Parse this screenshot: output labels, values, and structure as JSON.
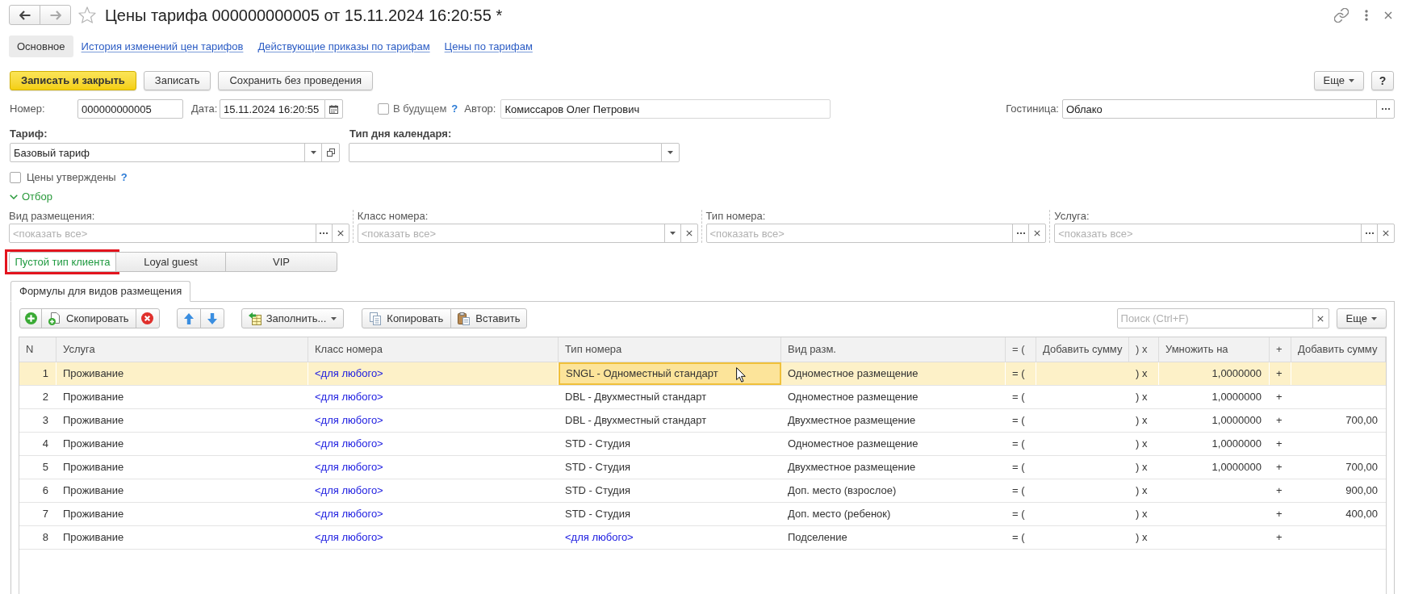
{
  "window": {
    "title": "Цены тарифа 000000000005 от 15.11.2024 16:20:55 *",
    "favorite": false
  },
  "form_tabs": [
    {
      "label": "Основное",
      "selected": true
    },
    {
      "label": "История изменений цен тарифов",
      "selected": false
    },
    {
      "label": "Действующие приказы по тарифам",
      "selected": false
    },
    {
      "label": "Цены по тарифам",
      "selected": false
    }
  ],
  "command_bar": {
    "buttons": [
      {
        "label": "Записать и закрыть",
        "kind": "primary"
      },
      {
        "label": "Записать",
        "kind": "default"
      },
      {
        "label": "Сохранить без проведения",
        "kind": "default"
      }
    ],
    "more": "Еще",
    "help": "?"
  },
  "header": {
    "number": {
      "label": "Номер:",
      "value": "000000000005"
    },
    "date": {
      "label": "Дата:",
      "value": "15.11.2024 16:20:55"
    },
    "future": {
      "label": "В будущем",
      "checked": false,
      "hint": "?"
    },
    "author": {
      "label": "Автор:",
      "value": "Комиссаров Олег Петрович"
    },
    "hotel": {
      "label": "Гостиница:",
      "value": "Облако"
    }
  },
  "tariff": {
    "label": "Тариф:",
    "value": "Базовый тариф"
  },
  "calendar_day_type": {
    "label": "Тип дня календаря:"
  },
  "prices_approved": {
    "label": "Цены утверждены",
    "checked": false,
    "hint": "?"
  },
  "filter": {
    "label": "Отбор",
    "expanded": true,
    "fields": [
      {
        "label": "Вид размещения:",
        "placeholder": "<показать все>",
        "kind": "choice"
      },
      {
        "label": "Класс номера:",
        "placeholder": "<показать все>",
        "kind": "dropdown"
      },
      {
        "label": "Тип номера:",
        "placeholder": "<показать все>",
        "kind": "choice"
      },
      {
        "label": "Услуга:",
        "placeholder": "<показать все>",
        "kind": "choice"
      }
    ]
  },
  "client_types": [
    {
      "label": "Пустой тип клиента",
      "selected": true,
      "highlighted": true
    },
    {
      "label": "Loyal guest",
      "selected": false,
      "highlighted": false
    },
    {
      "label": "VIP",
      "selected": false,
      "highlighted": false
    }
  ],
  "inner_tabs": [
    {
      "label": "Формулы для видов размещения",
      "selected": true
    }
  ],
  "toolbar": {
    "copy_row": "Скопировать",
    "fill": "Заполнить...",
    "copy": "Копировать",
    "paste": "Вставить",
    "search": {
      "placeholder": "Поиск (Ctrl+F)"
    },
    "more": "Еще"
  },
  "table": {
    "columns": [
      "N",
      "Услуга",
      "Класс номера",
      "Тип номера",
      "Вид разм.",
      "= (",
      "Добавить сумму",
      ") x",
      "Умножить на",
      "+",
      "Добавить сумму"
    ],
    "rows": [
      {
        "n": "1",
        "service": "Проживание",
        "room_class": "<для любого>",
        "room_class_any": true,
        "room_type": "SNGL - Одноместный стандарт",
        "room_type_any": false,
        "accommodation": "Одноместное размещение",
        "open": "= (",
        "close": ") x",
        "multiply": "1,0000000",
        "plus": "+",
        "selected": true,
        "focused": true
      },
      {
        "n": "2",
        "service": "Проживание",
        "room_class": "<для любого>",
        "room_class_any": true,
        "room_type": "DBL - Двухместный стандарт",
        "room_type_any": false,
        "accommodation": "Одноместное размещение",
        "open": "= (",
        "close": ") x",
        "multiply": "1,0000000",
        "plus": "+",
        "selected": false,
        "focused": false
      },
      {
        "n": "3",
        "service": "Проживание",
        "room_class": "<для любого>",
        "room_class_any": true,
        "room_type": "DBL - Двухместный стандарт",
        "room_type_any": false,
        "accommodation": "Двухместное размещение",
        "open": "= (",
        "close": ") x",
        "multiply": "1,0000000",
        "plus": "+",
        "add_sum_2": "700,00",
        "selected": false,
        "focused": false
      },
      {
        "n": "4",
        "service": "Проживание",
        "room_class": "<для любого>",
        "room_class_any": true,
        "room_type": "STD - Студия",
        "room_type_any": false,
        "accommodation": "Одноместное размещение",
        "open": "= (",
        "close": ") x",
        "multiply": "1,0000000",
        "plus": "+",
        "selected": false,
        "focused": false
      },
      {
        "n": "5",
        "service": "Проживание",
        "room_class": "<для любого>",
        "room_class_any": true,
        "room_type": "STD - Студия",
        "room_type_any": false,
        "accommodation": "Двухместное размещение",
        "open": "= (",
        "close": ") x",
        "multiply": "1,0000000",
        "plus": "+",
        "add_sum_2": "700,00",
        "selected": false,
        "focused": false
      },
      {
        "n": "6",
        "service": "Проживание",
        "room_class": "<для любого>",
        "room_class_any": true,
        "room_type": "STD - Студия",
        "room_type_any": false,
        "accommodation": "Доп. место (взрослое)",
        "open": "= (",
        "close": ") x",
        "plus": "+",
        "add_sum_2": "900,00",
        "selected": false,
        "focused": false
      },
      {
        "n": "7",
        "service": "Проживание",
        "room_class": "<для любого>",
        "room_class_any": true,
        "room_type": "STD - Студия",
        "room_type_any": false,
        "accommodation": "Доп. место (ребенок)",
        "open": "= (",
        "close": ") x",
        "plus": "+",
        "add_sum_2": "400,00",
        "selected": false,
        "focused": false
      },
      {
        "n": "8",
        "service": "Проживание",
        "room_class": "<для любого>",
        "room_class_any": true,
        "room_type": "<для любого>",
        "room_type_any": true,
        "accommodation": "Подселение",
        "open": "= (",
        "close": ") x",
        "plus": "+",
        "selected": false,
        "focused": false
      }
    ]
  }
}
